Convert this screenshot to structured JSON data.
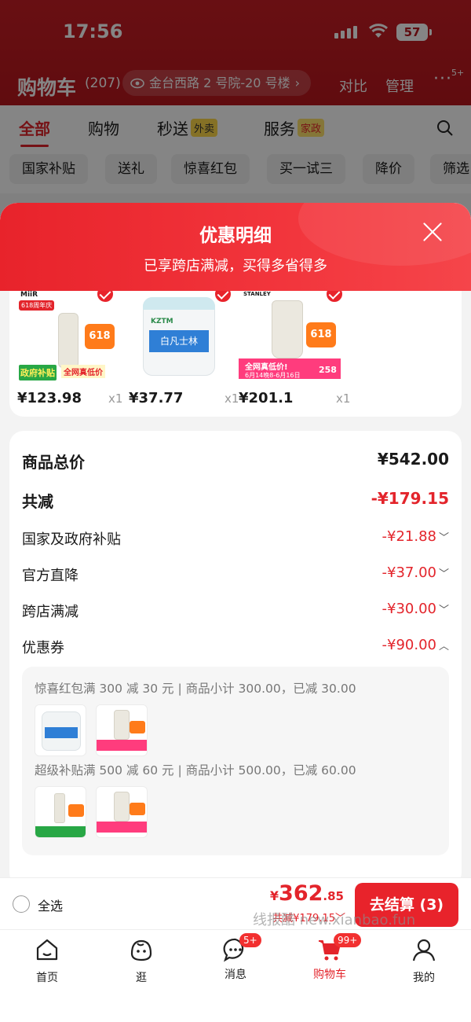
{
  "status_bar": {
    "time": "17:56",
    "battery": "57"
  },
  "header": {
    "title": "购物车",
    "count": "(207)",
    "address": "金台西路 2 号院-20 号楼",
    "compare": "对比",
    "manage": "管理",
    "more_badge": "5+"
  },
  "tabs": [
    {
      "label": "全部"
    },
    {
      "label": "购物"
    },
    {
      "label": "秒送",
      "tag": "外卖"
    },
    {
      "label": "服务",
      "tag": "家政"
    }
  ],
  "chips": [
    "国家补贴",
    "送礼",
    "惊喜红包",
    "买一试三",
    "降价",
    "筛选"
  ],
  "sheet": {
    "title": "优惠明细",
    "subtitle": "已享跨店满减，买得多省得多",
    "products": [
      {
        "price": "¥123.98",
        "qty": "x1",
        "badge_text": "政府补贴",
        "sale_text": "全网真低价",
        "brand": "MiiR",
        "tag": "618周年庆"
      },
      {
        "price": "¥37.77",
        "qty": "x1",
        "label": "白凡士林",
        "brand": "KZTM"
      },
      {
        "price": "¥201.1",
        "qty": "x1",
        "sale_text": "全网真低价!",
        "brand": "STANLEY",
        "date": "6月14晚8-6月16日",
        "num": "258"
      }
    ],
    "summary": {
      "total_label": "商品总价",
      "total_value": "¥542.00",
      "reduce_label": "共减",
      "reduce_value": "-¥179.15",
      "items": [
        {
          "label": "国家及政府补贴",
          "value": "-¥21.88",
          "caret": "﹀"
        },
        {
          "label": "官方直降",
          "value": "-¥37.00",
          "caret": "﹀"
        },
        {
          "label": "跨店满减",
          "value": "-¥30.00",
          "caret": "﹀"
        },
        {
          "label": "优惠券",
          "value": "-¥90.00",
          "caret": "︿"
        }
      ],
      "coupons": [
        {
          "text": "惊喜红包满 300 减 30 元 | 商品小计 300.00，已减 30.00"
        },
        {
          "text": "超级补贴满 500 减 60 元 | 商品小计 500.00，已减 60.00"
        }
      ]
    }
  },
  "checkout": {
    "select_all": "全选",
    "currency": "¥",
    "total_int": "362",
    "total_dec": ".85",
    "saved": "共减¥179.15﹀",
    "pay_button": "去结算 (3)",
    "watermark": "线报酷 new.xianbao.fun"
  },
  "bottom_nav": [
    {
      "label": "首页",
      "icon": "home-icon"
    },
    {
      "label": "逛",
      "icon": "browse-icon"
    },
    {
      "label": "消息",
      "icon": "message-icon",
      "badge": "5+"
    },
    {
      "label": "购物车",
      "icon": "cart-icon",
      "badge": "99+"
    },
    {
      "label": "我的",
      "icon": "profile-icon"
    }
  ],
  "colors": {
    "brand_red": "#e3242b",
    "header_red": "#c81e25"
  }
}
